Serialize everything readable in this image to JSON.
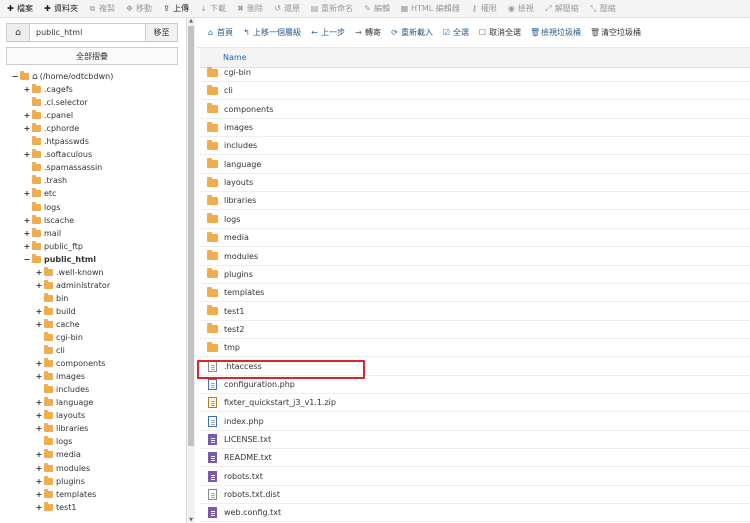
{
  "toolbar": [
    {
      "label": "檔案",
      "icon": "plus-icon",
      "ic": "✚",
      "disabled": false
    },
    {
      "label": "資料夾",
      "icon": "plus-icon",
      "ic": "✚",
      "disabled": false
    },
    {
      "label": "複製",
      "icon": "copy-icon",
      "ic": "⧉",
      "disabled": true
    },
    {
      "label": "移動",
      "icon": "move-icon",
      "ic": "✥",
      "disabled": true
    },
    {
      "label": "上傳",
      "icon": "upload-icon",
      "ic": "⇪",
      "disabled": false
    },
    {
      "label": "下載",
      "icon": "download-icon",
      "ic": "⤓",
      "disabled": true
    },
    {
      "label": "刪除",
      "icon": "delete-icon",
      "ic": "✖",
      "disabled": true
    },
    {
      "label": "還原",
      "icon": "restore-icon",
      "ic": "↺",
      "disabled": true
    },
    {
      "label": "重新命名",
      "icon": "rename-icon",
      "ic": "▤",
      "disabled": true
    },
    {
      "label": "編輯",
      "icon": "edit-icon",
      "ic": "✎",
      "disabled": true
    },
    {
      "label": "HTML 編輯器",
      "icon": "html-editor-icon",
      "ic": "▦",
      "disabled": true
    },
    {
      "label": "權限",
      "icon": "key-icon",
      "ic": "⚷",
      "disabled": true
    },
    {
      "label": "檢視",
      "icon": "eye-icon",
      "ic": "◉",
      "disabled": true
    },
    {
      "label": "解壓縮",
      "icon": "extract-icon",
      "ic": "⤢",
      "disabled": true
    },
    {
      "label": "壓縮",
      "icon": "compress-icon",
      "ic": "⤡",
      "disabled": true
    }
  ],
  "path": {
    "home_icon": "home-icon",
    "value": "public_html",
    "go_label": "移至"
  },
  "collapse_all_label": "全部摺疊",
  "tree": [
    {
      "label": "(/home/odtcbdwn)",
      "depth": 0,
      "toggle": "−",
      "home": true,
      "bold": false
    },
    {
      "label": ".cagefs",
      "depth": 1,
      "toggle": "+",
      "bold": false
    },
    {
      "label": ".cl.selector",
      "depth": 1,
      "toggle": "",
      "bold": false
    },
    {
      "label": ".cpanel",
      "depth": 1,
      "toggle": "+",
      "bold": false
    },
    {
      "label": ".cphorde",
      "depth": 1,
      "toggle": "+",
      "bold": false
    },
    {
      "label": ".htpasswds",
      "depth": 1,
      "toggle": "",
      "bold": false
    },
    {
      "label": ".softaculous",
      "depth": 1,
      "toggle": "+",
      "bold": false
    },
    {
      "label": ".spamassassin",
      "depth": 1,
      "toggle": "",
      "bold": false
    },
    {
      "label": ".trash",
      "depth": 1,
      "toggle": "",
      "bold": false
    },
    {
      "label": "etc",
      "depth": 1,
      "toggle": "+",
      "bold": false
    },
    {
      "label": "logs",
      "depth": 1,
      "toggle": "",
      "bold": false
    },
    {
      "label": "lscache",
      "depth": 1,
      "toggle": "+",
      "bold": false
    },
    {
      "label": "mail",
      "depth": 1,
      "toggle": "+",
      "bold": false
    },
    {
      "label": "public_ftp",
      "depth": 1,
      "toggle": "+",
      "bold": false
    },
    {
      "label": "public_html",
      "depth": 1,
      "toggle": "−",
      "bold": true
    },
    {
      "label": ".well-known",
      "depth": 2,
      "toggle": "+",
      "bold": false
    },
    {
      "label": "administrator",
      "depth": 2,
      "toggle": "+",
      "bold": false
    },
    {
      "label": "bin",
      "depth": 2,
      "toggle": "",
      "bold": false
    },
    {
      "label": "build",
      "depth": 2,
      "toggle": "+",
      "bold": false
    },
    {
      "label": "cache",
      "depth": 2,
      "toggle": "+",
      "bold": false
    },
    {
      "label": "cgi-bin",
      "depth": 2,
      "toggle": "",
      "bold": false
    },
    {
      "label": "cli",
      "depth": 2,
      "toggle": "",
      "bold": false
    },
    {
      "label": "components",
      "depth": 2,
      "toggle": "+",
      "bold": false
    },
    {
      "label": "images",
      "depth": 2,
      "toggle": "+",
      "bold": false
    },
    {
      "label": "includes",
      "depth": 2,
      "toggle": "",
      "bold": false
    },
    {
      "label": "language",
      "depth": 2,
      "toggle": "+",
      "bold": false
    },
    {
      "label": "layouts",
      "depth": 2,
      "toggle": "+",
      "bold": false
    },
    {
      "label": "libraries",
      "depth": 2,
      "toggle": "+",
      "bold": false
    },
    {
      "label": "logs",
      "depth": 2,
      "toggle": "",
      "bold": false
    },
    {
      "label": "media",
      "depth": 2,
      "toggle": "+",
      "bold": false
    },
    {
      "label": "modules",
      "depth": 2,
      "toggle": "+",
      "bold": false
    },
    {
      "label": "plugins",
      "depth": 2,
      "toggle": "+",
      "bold": false
    },
    {
      "label": "templates",
      "depth": 2,
      "toggle": "+",
      "bold": false
    },
    {
      "label": "test1",
      "depth": 2,
      "toggle": "+",
      "bold": false
    }
  ],
  "actions": [
    {
      "label": "首頁",
      "icon": "home-icon",
      "ic": "⌂",
      "dark": false
    },
    {
      "label": "上移一個層級",
      "icon": "level-up-icon",
      "ic": "↰",
      "dark": false
    },
    {
      "label": "上一步",
      "icon": "back-icon",
      "ic": "←",
      "dark": false
    },
    {
      "label": "轉寄",
      "icon": "forward-icon",
      "ic": "→",
      "dark": true
    },
    {
      "label": "重新載入",
      "icon": "reload-icon",
      "ic": "⟳",
      "dark": false
    },
    {
      "label": "全選",
      "icon": "select-all-icon",
      "ic": "☑",
      "dark": false
    },
    {
      "label": "取消全選",
      "icon": "unselect-all-icon",
      "ic": "☐",
      "dark": true
    },
    {
      "label": "檢視垃圾桶",
      "icon": "trash-icon",
      "ic": "🗑",
      "dark": false
    },
    {
      "label": "清空垃圾桶",
      "icon": "empty-trash-icon",
      "ic": "🗑",
      "dark": true
    }
  ],
  "columns": {
    "name": "Name"
  },
  "files": [
    {
      "name": "cgi-bin",
      "type": "folder",
      "icon": "folder-icon"
    },
    {
      "name": "cli",
      "type": "folder",
      "icon": "folder-icon"
    },
    {
      "name": "components",
      "type": "folder",
      "icon": "folder-icon"
    },
    {
      "name": "images",
      "type": "folder",
      "icon": "folder-icon"
    },
    {
      "name": "includes",
      "type": "folder",
      "icon": "folder-icon"
    },
    {
      "name": "language",
      "type": "folder",
      "icon": "folder-icon"
    },
    {
      "name": "layouts",
      "type": "folder",
      "icon": "folder-icon"
    },
    {
      "name": "libraries",
      "type": "folder",
      "icon": "folder-icon"
    },
    {
      "name": "logs",
      "type": "folder",
      "icon": "folder-icon"
    },
    {
      "name": "media",
      "type": "folder",
      "icon": "folder-icon"
    },
    {
      "name": "modules",
      "type": "folder",
      "icon": "folder-icon"
    },
    {
      "name": "plugins",
      "type": "folder",
      "icon": "folder-icon"
    },
    {
      "name": "templates",
      "type": "folder",
      "icon": "folder-icon"
    },
    {
      "name": "test1",
      "type": "folder",
      "icon": "folder-icon"
    },
    {
      "name": "test2",
      "type": "folder",
      "icon": "folder-icon"
    },
    {
      "name": "tmp",
      "type": "folder",
      "icon": "folder-icon"
    },
    {
      "name": ".htaccess",
      "type": "gen",
      "icon": "text-file-icon",
      "highlighted": true
    },
    {
      "name": "configuration.php",
      "type": "code",
      "icon": "php-file-icon"
    },
    {
      "name": "fixter_quickstart_j3_v1.1.zip",
      "type": "zip",
      "icon": "zip-file-icon"
    },
    {
      "name": "index.php",
      "type": "code",
      "icon": "php-file-icon"
    },
    {
      "name": "LICENSE.txt",
      "type": "txt",
      "icon": "text-file-icon"
    },
    {
      "name": "README.txt",
      "type": "txt",
      "icon": "text-file-icon"
    },
    {
      "name": "robots.txt",
      "type": "txt",
      "icon": "text-file-icon"
    },
    {
      "name": "robots.txt.dist",
      "type": "gen",
      "icon": "file-icon"
    },
    {
      "name": "web.config.txt",
      "type": "txt",
      "icon": "text-file-icon"
    }
  ],
  "colors": {
    "accent": "#2a6aa8",
    "folder": "#f0ad4e",
    "highlight": "#d9262e"
  }
}
